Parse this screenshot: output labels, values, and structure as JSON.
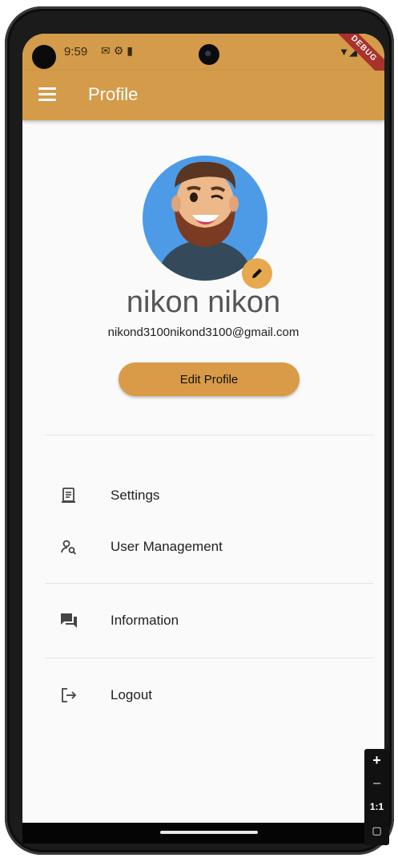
{
  "status_bar": {
    "time": "9:59",
    "icons": [
      "gmail-icon",
      "settings-icon",
      "sd-card-icon"
    ],
    "right_icons": [
      "wifi-icon",
      "signal-icon",
      "battery-icon"
    ],
    "debug_label": "DEBUG"
  },
  "app_bar": {
    "title": "Profile"
  },
  "profile": {
    "name": "nikon nikon",
    "email": "nikond3100nikond3100@gmail.com",
    "edit_button": "Edit Profile"
  },
  "menu": [
    {
      "label": "Settings",
      "icon": "settings-document-icon"
    },
    {
      "label": "User Management",
      "icon": "user-search-icon"
    },
    {
      "label": "Information",
      "icon": "chat-bubbles-icon"
    },
    {
      "label": "Logout",
      "icon": "logout-icon"
    }
  ],
  "zoom_controls": {
    "zoom_in": "+",
    "zoom_out": "−",
    "reset": "1:1"
  },
  "colors": {
    "accent": "#d39b4a",
    "button": "#d99b48",
    "avatar_bg": "#4d9be6",
    "debug": "#a8322c"
  }
}
